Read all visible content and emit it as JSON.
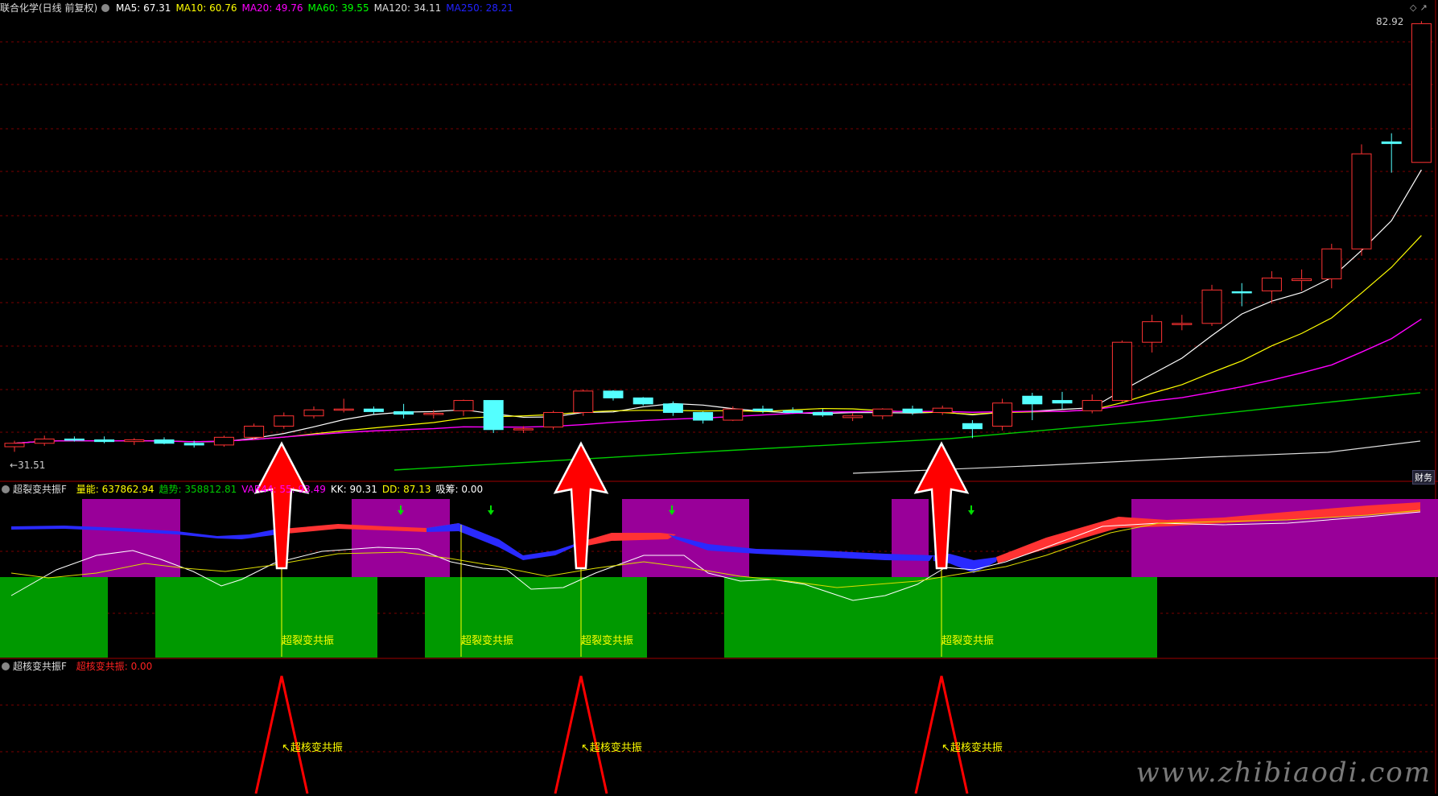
{
  "main_panel": {
    "title": "联合化学(日线 前复权)",
    "indicators": [
      {
        "label": "MA5: 67.31",
        "color": "#ffffff"
      },
      {
        "label": "MA10: 60.76",
        "color": "#ffff00"
      },
      {
        "label": "MA20: 49.76",
        "color": "#ff00ff"
      },
      {
        "label": "MA60: 39.55",
        "color": "#00ff00"
      },
      {
        "label": "MA120: 34.11",
        "color": "#dddddd"
      },
      {
        "label": "MA250: 28.21",
        "color": "#2222ff"
      }
    ],
    "price_high": "82.92",
    "price_low": "31.51",
    "badge": "财务"
  },
  "indicator1": {
    "title": "超裂变共振F",
    "values": [
      {
        "label": "量能: 637862.94",
        "color": "#ffff00"
      },
      {
        "label": "趋势: 358812.81",
        "color": "#00cc00"
      },
      {
        "label": "VAR44: 55: 93.49",
        "color": "#ff00ff"
      },
      {
        "label": "KK: 90.31",
        "color": "#ffffff"
      },
      {
        "label": "DD: 87.13",
        "color": "#ffff00"
      },
      {
        "label": "吸筹: 0.00",
        "color": "#ffffff"
      }
    ],
    "signal_text": "超裂变共振"
  },
  "indicator2": {
    "title": "超核变共振F",
    "value_label": "超核变共振: 0.00",
    "signal_text": "超核变共振"
  },
  "watermark": "www.zhibiaodi.com",
  "colors": {
    "up": "#ff3333",
    "down": "#54ffff",
    "grid": "#7a0000",
    "purple": "#990099",
    "green": "#009900",
    "arrow": "#ff0000"
  },
  "chart_data": {
    "type": "candlestick",
    "ylim": [
      31.51,
      82.92
    ],
    "candles": [
      [
        33.2,
        33.9,
        32.6,
        33.6
      ],
      [
        33.6,
        34.5,
        33.3,
        34.1
      ],
      [
        34.1,
        34.4,
        33.8,
        34.0
      ],
      [
        34.0,
        34.4,
        33.6,
        33.8
      ],
      [
        33.8,
        34.2,
        33.4,
        34.0
      ],
      [
        34.0,
        34.3,
        33.5,
        33.6
      ],
      [
        33.6,
        33.9,
        33.1,
        33.4
      ],
      [
        33.4,
        34.5,
        33.2,
        34.3
      ],
      [
        34.3,
        35.9,
        34.0,
        35.6
      ],
      [
        35.6,
        37.2,
        35.3,
        36.8
      ],
      [
        36.8,
        37.9,
        36.5,
        37.5
      ],
      [
        37.5,
        38.8,
        37.2,
        37.6
      ],
      [
        37.6,
        37.9,
        37.0,
        37.3
      ],
      [
        37.3,
        38.2,
        36.5,
        37.0
      ],
      [
        37.0,
        37.5,
        36.5,
        37.1
      ],
      [
        37.4,
        38.7,
        36.8,
        38.6
      ],
      [
        38.6,
        38.6,
        34.8,
        35.2
      ],
      [
        35.2,
        35.6,
        34.8,
        35.3
      ],
      [
        35.5,
        37.4,
        35.2,
        37.2
      ],
      [
        37.2,
        39.9,
        36.8,
        39.7
      ],
      [
        39.7,
        39.8,
        38.6,
        38.9
      ],
      [
        38.9,
        39.0,
        38.0,
        38.2
      ],
      [
        38.2,
        38.5,
        36.8,
        37.2
      ],
      [
        37.2,
        37.3,
        35.9,
        36.3
      ],
      [
        36.3,
        37.9,
        36.2,
        37.6
      ],
      [
        37.6,
        38.0,
        37.1,
        37.4
      ],
      [
        37.4,
        37.8,
        37.1,
        37.2
      ],
      [
        37.2,
        37.6,
        36.7,
        36.9
      ],
      [
        36.6,
        37.1,
        36.2,
        36.8
      ],
      [
        36.8,
        37.7,
        36.4,
        37.6
      ],
      [
        37.6,
        38.0,
        36.9,
        37.2
      ],
      [
        37.2,
        38.0,
        36.9,
        37.7
      ],
      [
        35.9,
        36.3,
        34.2,
        35.3
      ],
      [
        35.6,
        38.8,
        35.1,
        38.3
      ],
      [
        39.1,
        39.5,
        36.3,
        38.2
      ],
      [
        38.6,
        39.6,
        37.6,
        38.3
      ],
      [
        37.4,
        39.3,
        37.1,
        38.6
      ],
      [
        38.6,
        45.6,
        38.4,
        45.4
      ],
      [
        45.4,
        48.6,
        44.2,
        47.8
      ],
      [
        47.6,
        48.6,
        46.8,
        47.6
      ],
      [
        47.6,
        52.1,
        47.3,
        51.5
      ],
      [
        51.3,
        52.3,
        49.6,
        51.2
      ],
      [
        51.4,
        53.7,
        49.9,
        52.9
      ],
      [
        52.6,
        53.9,
        51.4,
        52.8
      ],
      [
        52.8,
        56.9,
        51.7,
        56.3
      ],
      [
        56.3,
        68.5,
        55.5,
        67.4
      ],
      [
        68.8,
        69.8,
        65.2,
        68.6
      ],
      [
        66.4,
        82.9,
        66.4,
        82.6
      ]
    ]
  }
}
